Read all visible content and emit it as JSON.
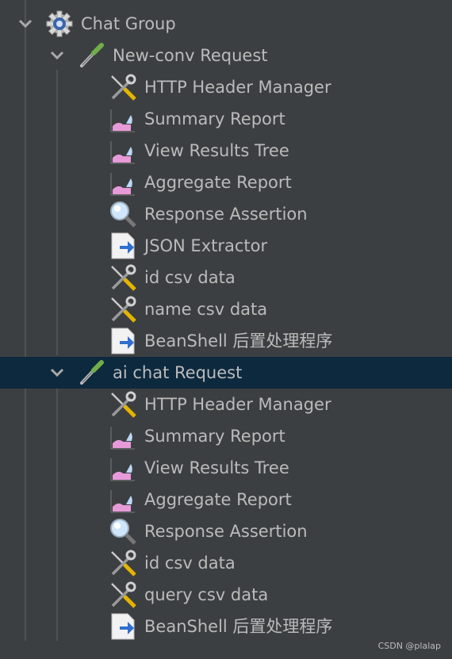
{
  "tree": {
    "group": {
      "label": "Chat Group",
      "icon": "thread-group-gear-icon",
      "expanded": true
    },
    "samplers": [
      {
        "label": "New-conv Request",
        "icon": "pipette-sampler-icon",
        "expanded": true,
        "selected": false,
        "children": [
          {
            "label": "HTTP Header Manager",
            "icon": "wrench-screwdriver-icon"
          },
          {
            "label": "Summary Report",
            "icon": "listener-chart-icon"
          },
          {
            "label": "View Results Tree",
            "icon": "listener-chart-icon"
          },
          {
            "label": "Aggregate Report",
            "icon": "listener-chart-icon"
          },
          {
            "label": "Response Assertion",
            "icon": "magnifier-icon"
          },
          {
            "label": "JSON Extractor",
            "icon": "post-processor-arrow-icon"
          },
          {
            "label": "id csv data",
            "icon": "wrench-screwdriver-icon"
          },
          {
            "label": "name csv data",
            "icon": "wrench-screwdriver-icon"
          },
          {
            "label": "BeanShell 后置处理程序",
            "icon": "post-processor-arrow-icon"
          }
        ]
      },
      {
        "label": "ai chat Request",
        "icon": "pipette-sampler-icon",
        "expanded": true,
        "selected": true,
        "children": [
          {
            "label": "HTTP Header Manager",
            "icon": "wrench-screwdriver-icon"
          },
          {
            "label": "Summary Report",
            "icon": "listener-chart-icon"
          },
          {
            "label": "View Results Tree",
            "icon": "listener-chart-icon"
          },
          {
            "label": "Aggregate Report",
            "icon": "listener-chart-icon"
          },
          {
            "label": "Response Assertion",
            "icon": "magnifier-icon"
          },
          {
            "label": "id csv data",
            "icon": "wrench-screwdriver-icon"
          },
          {
            "label": "query csv data",
            "icon": "wrench-screwdriver-icon"
          },
          {
            "label": "BeanShell 后置处理程序",
            "icon": "post-processor-arrow-icon"
          }
        ]
      }
    ]
  },
  "watermark": "CSDN @plalap",
  "colors": {
    "background": "#3c3f41",
    "selected_row": "#0d293e",
    "text": "#bbbbbb"
  }
}
